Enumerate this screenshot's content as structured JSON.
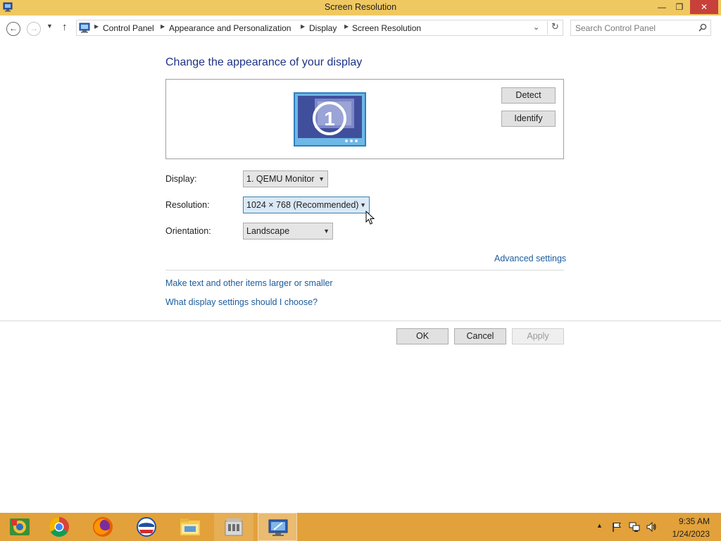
{
  "window": {
    "title": "Screen Resolution",
    "minimize_glyph": "—",
    "maximize_glyph": "❐",
    "close_glyph": "✕"
  },
  "navigation": {
    "back_glyph": "←",
    "forward_glyph": "→",
    "recent_glyph": "▼",
    "up_glyph": "↑",
    "breadcrumb": [
      "Control Panel",
      "Appearance and Personalization",
      "Display",
      "Screen Resolution"
    ],
    "search_placeholder": "Search Control Panel"
  },
  "main": {
    "heading": "Change the appearance of your display",
    "monitor_number": "1",
    "detect_label": "Detect",
    "identify_label": "Identify",
    "display_label": "Display:",
    "display_value": "1. QEMU Monitor",
    "resolution_label": "Resolution:",
    "resolution_value": "1024 × 768 (Recommended)",
    "orientation_label": "Orientation:",
    "orientation_value": "Landscape",
    "advanced_link": "Advanced settings",
    "text_size_link": "Make text and other items larger or smaller",
    "help_link": "What display settings should I choose?",
    "ok_label": "OK",
    "cancel_label": "Cancel",
    "apply_label": "Apply"
  },
  "taskbar": {
    "apps": [
      "control-panel-icon",
      "chrome-icon",
      "firefox-icon",
      "opera-icon",
      "file-explorer-icon",
      "store-icon",
      "display-settings-icon"
    ],
    "clock_time": "9:35 AM",
    "clock_date": "1/24/2023"
  },
  "colors": {
    "titlebar": "#f0c862",
    "taskbar": "#e2a13a",
    "heading": "#1e3287",
    "link": "#1b5c9c",
    "close_button": "#c7413a"
  }
}
